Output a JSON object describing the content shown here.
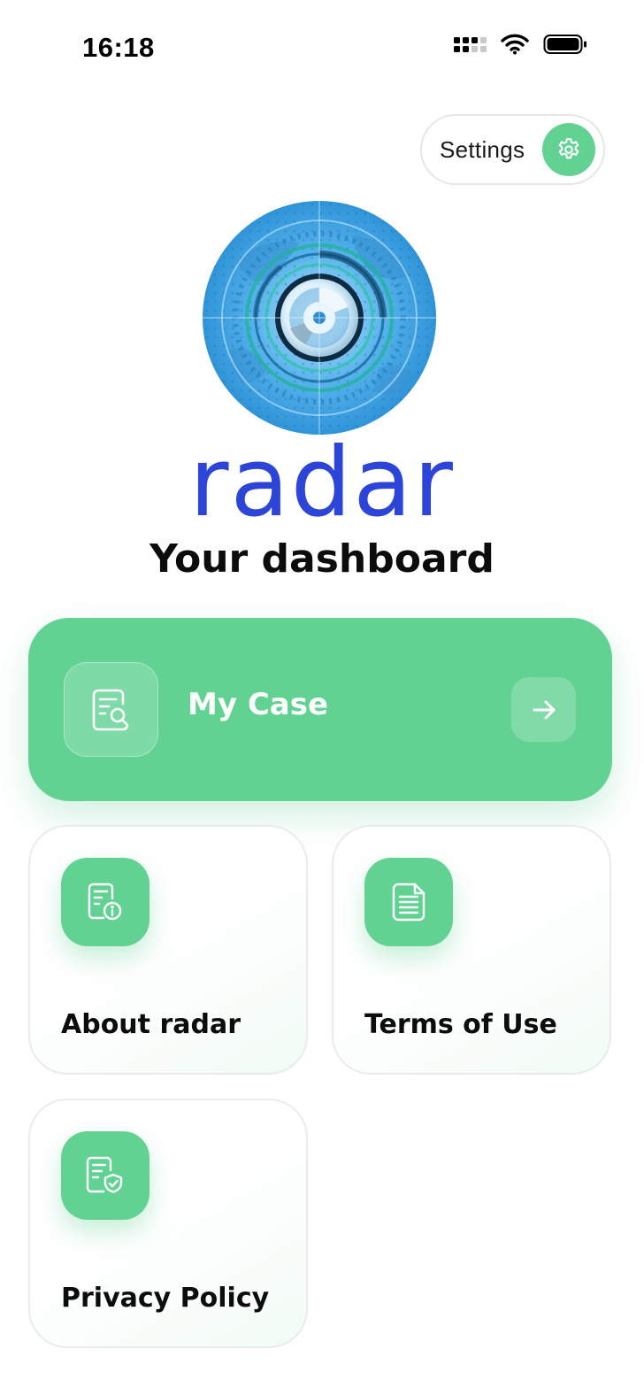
{
  "status_bar": {
    "time": "16:18"
  },
  "settings": {
    "label": "Settings",
    "icon": "gear-icon"
  },
  "logo": {
    "wordmark": "radar"
  },
  "page": {
    "title": "Your dashboard"
  },
  "case_card": {
    "label": "My Case",
    "icon": "document-search-icon",
    "action_icon": "arrow-right-icon"
  },
  "tiles": [
    {
      "label": "About radar",
      "icon": "document-info-icon"
    },
    {
      "label": "Terms of Use",
      "icon": "document-text-icon"
    },
    {
      "label": "Privacy Policy",
      "icon": "document-shield-icon"
    }
  ],
  "colors": {
    "accent_green": "#62d293",
    "logo_blue": "#2d44d8",
    "globe_blue": "#3fa5e6",
    "text_dark": "#0c0c0c"
  }
}
